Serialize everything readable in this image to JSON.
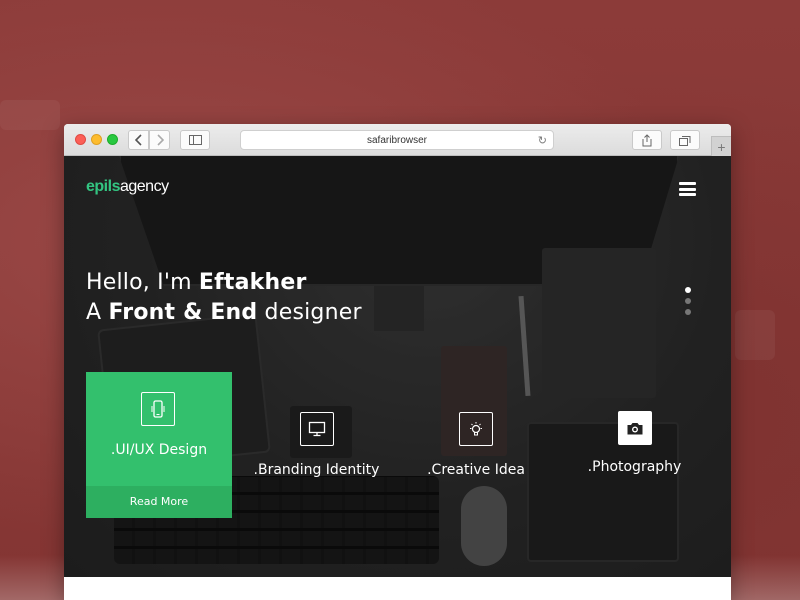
{
  "browser": {
    "address": "safaribrowser",
    "new_tab_label": "+"
  },
  "site": {
    "logo_part1": "epils",
    "logo_part2": "agency",
    "headline_line1_prefix": "Hello, I'm ",
    "headline_line1_name": "Eftakher",
    "headline_line2_prefix": "A ",
    "headline_line2_bold": "Front & End",
    "headline_line2_suffix": " designer",
    "pager_dots": 3,
    "pager_active_index": 0,
    "accent_color": "#33c06d",
    "services": [
      {
        "label": ".UI/UX Design",
        "icon": "mobile-phone-icon",
        "cta": "Read More",
        "highlighted": true
      },
      {
        "label": ".Branding Identity",
        "icon": "monitor-icon",
        "highlighted": false
      },
      {
        "label": ".Creative Idea",
        "icon": "lightbulb-icon",
        "highlighted": false
      },
      {
        "label": ".Photography",
        "icon": "camera-icon",
        "highlighted": false
      }
    ]
  }
}
